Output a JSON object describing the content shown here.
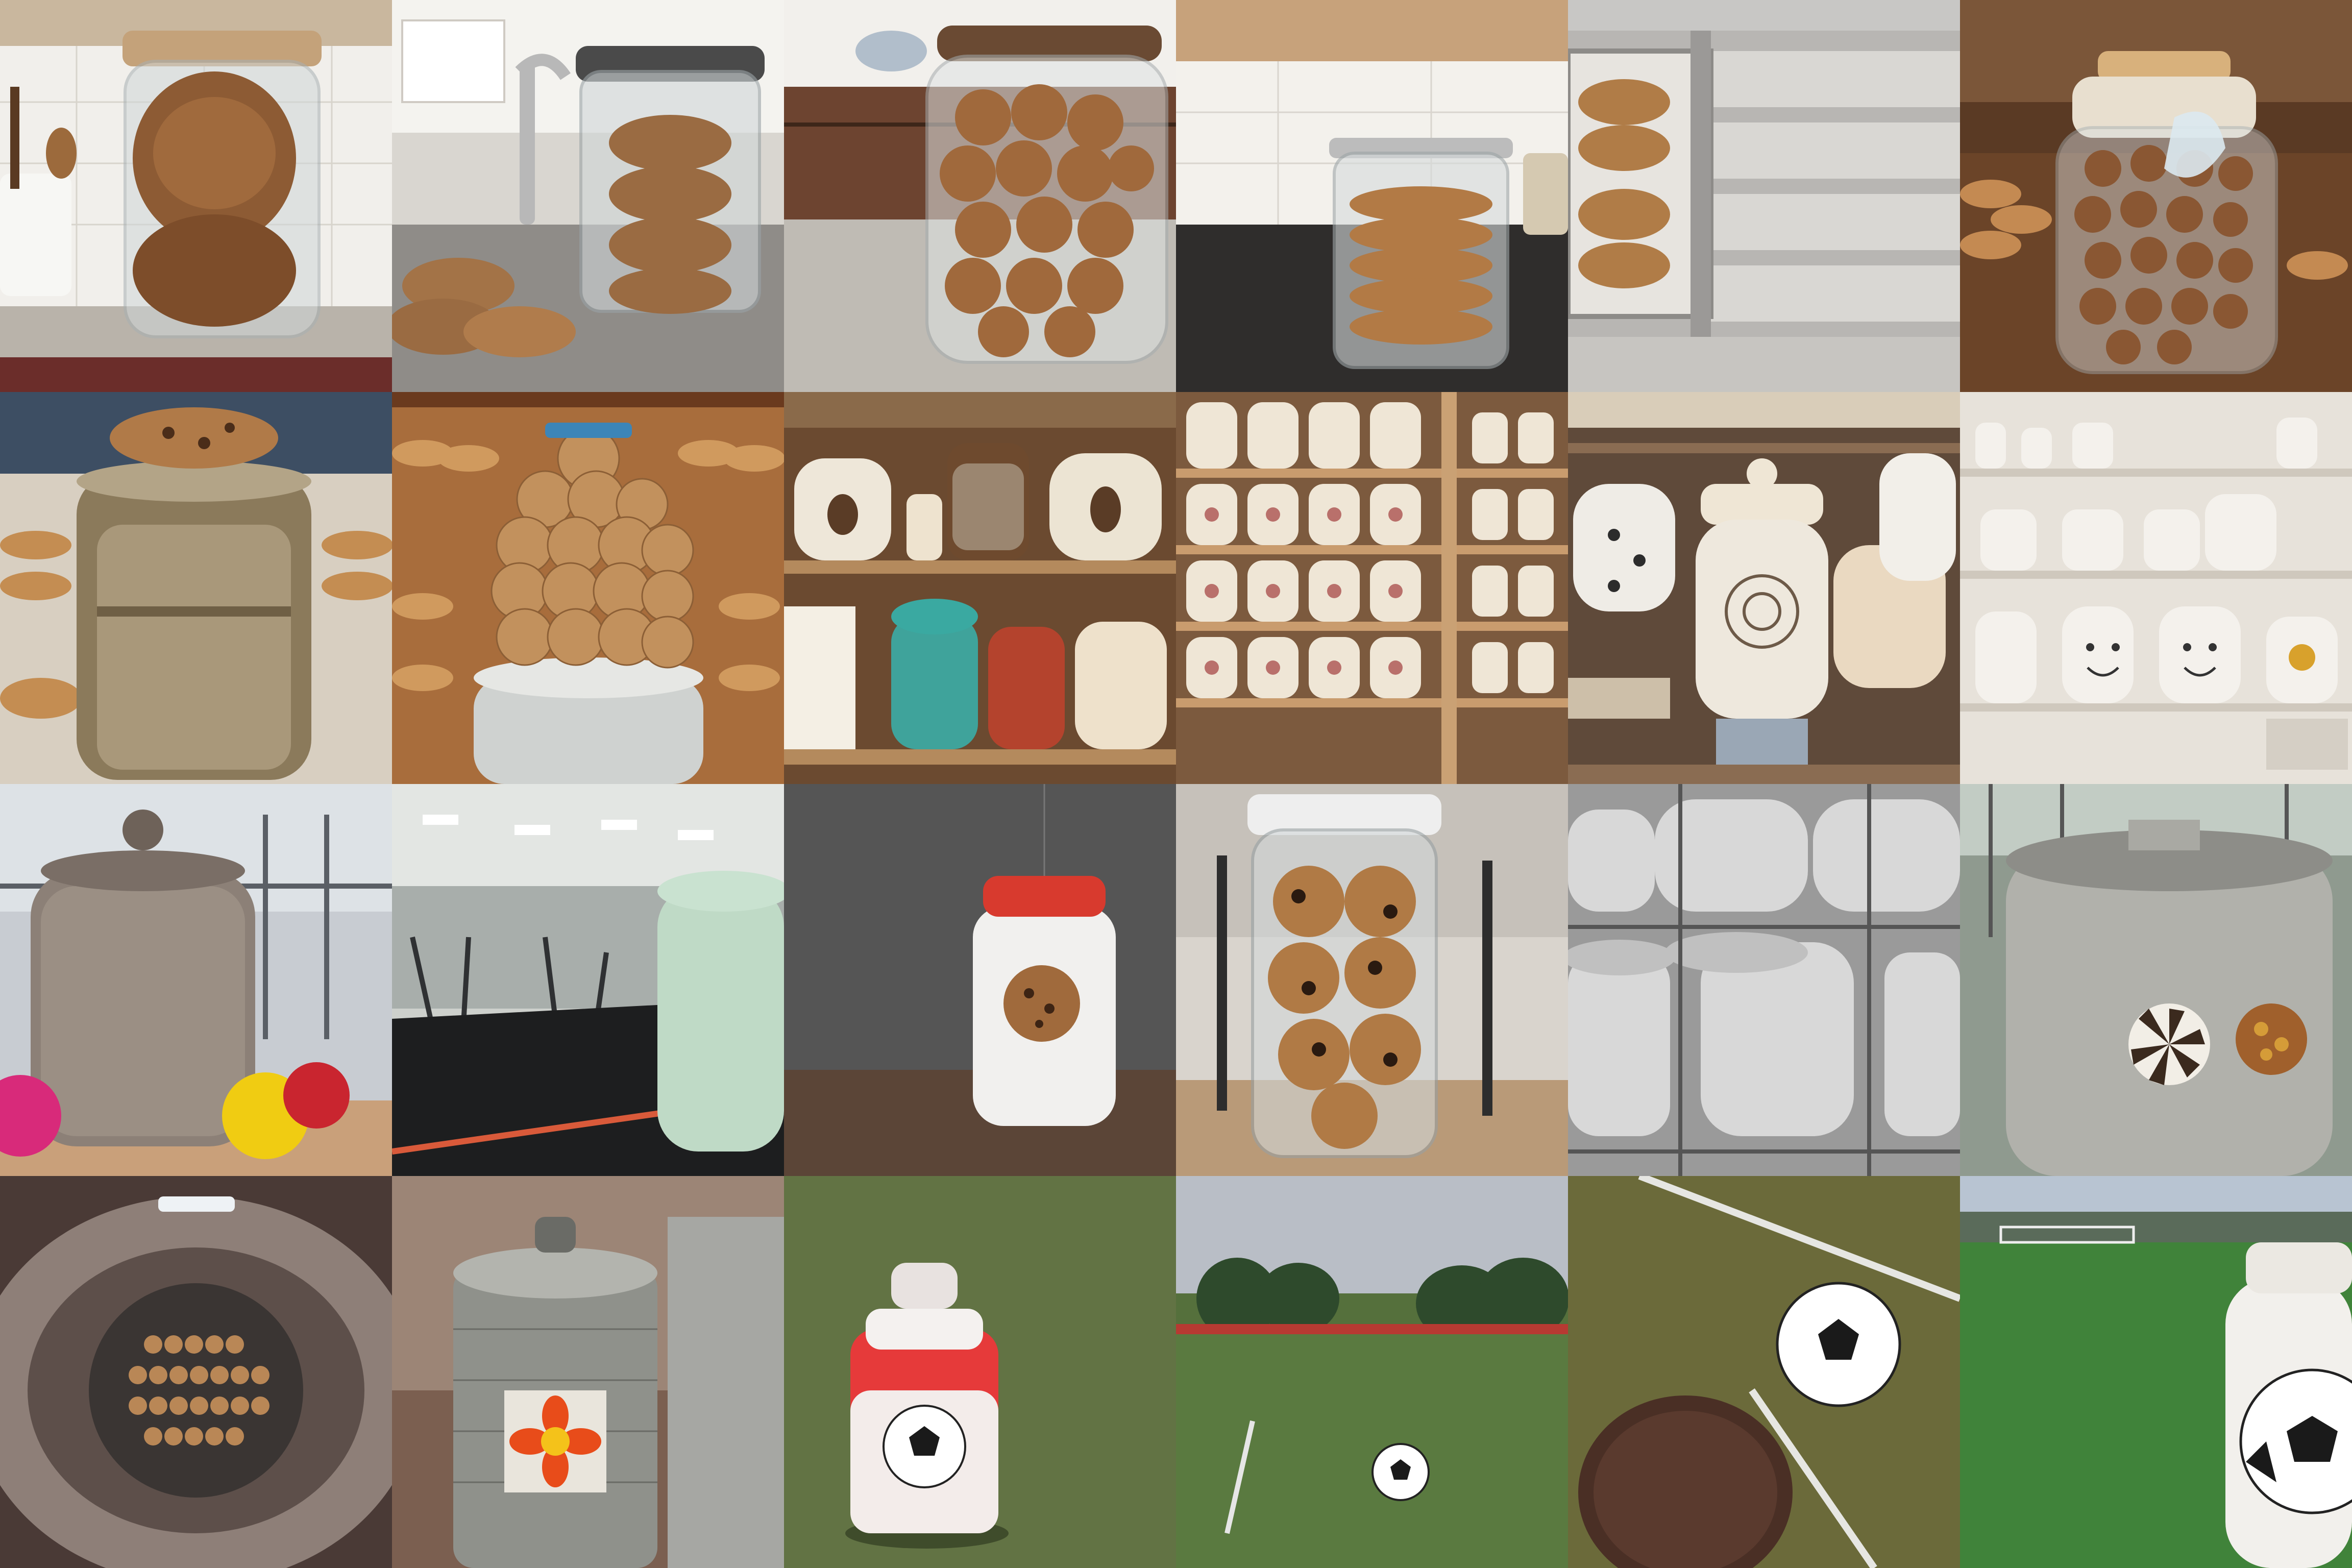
{
  "layout": {
    "rows": 4,
    "columns": 6
  },
  "tiles": [
    {
      "row": 1,
      "col": 1,
      "scene": "kitchen-counter",
      "subject": "glass-jar-large-cookies"
    },
    {
      "row": 1,
      "col": 2,
      "scene": "kitchen-sink",
      "subject": "glass-jar-stacked-cookies"
    },
    {
      "row": 1,
      "col": 3,
      "scene": "kitchen-counter",
      "subject": "glass-jar-full-cookies"
    },
    {
      "row": 1,
      "col": 4,
      "scene": "kitchen-counter",
      "subject": "clip-top-jar-stacked-cookies"
    },
    {
      "row": 1,
      "col": 5,
      "scene": "metal-shelf",
      "subject": "cookies-behind-glass"
    },
    {
      "row": 1,
      "col": 6,
      "scene": "bakery-counter",
      "subject": "glass-jar-assorted-cookies"
    },
    {
      "row": 2,
      "col": 1,
      "scene": "bakery",
      "subject": "metal-canister-cookie-on-lid"
    },
    {
      "row": 2,
      "col": 2,
      "scene": "bakery",
      "subject": "jar-topped-with-cookie-tower"
    },
    {
      "row": 2,
      "col": 3,
      "scene": "shop-shelves",
      "subject": "ceramic-jars"
    },
    {
      "row": 2,
      "col": 4,
      "scene": "shop-shelves",
      "subject": "painted-ceramic-jar-rows"
    },
    {
      "row": 2,
      "col": 5,
      "scene": "shop-shelf",
      "subject": "speckled-ceramic-jar"
    },
    {
      "row": 2,
      "col": 6,
      "scene": "shop-shelves",
      "subject": "ceramic-face-jars"
    },
    {
      "row": 3,
      "col": 1,
      "scene": "gym",
      "subject": "speckled-jar-with-balls"
    },
    {
      "row": 3,
      "col": 2,
      "scene": "gym",
      "subject": "mint-green-jar"
    },
    {
      "row": 3,
      "col": 3,
      "scene": "studio",
      "subject": "white-jar-cookie-emblem"
    },
    {
      "row": 3,
      "col": 4,
      "scene": "gym",
      "subject": "glass-jar-chocolate-cookies"
    },
    {
      "row": 3,
      "col": 5,
      "scene": "industrial",
      "subject": "white-steel-tanks"
    },
    {
      "row": 3,
      "col": 6,
      "scene": "industrial",
      "subject": "grey-tank-cookie-window"
    },
    {
      "row": 4,
      "col": 1,
      "scene": "vault",
      "subject": "round-vault-of-cookies"
    },
    {
      "row": 4,
      "col": 2,
      "scene": "factory",
      "subject": "steel-tank-flower-emblem"
    },
    {
      "row": 4,
      "col": 3,
      "scene": "soccer-field",
      "subject": "red-white-jar-with-ball"
    },
    {
      "row": 4,
      "col": 4,
      "scene": "soccer-field",
      "subject": "ball-on-grass"
    },
    {
      "row": 4,
      "col": 5,
      "scene": "soccer-field",
      "subject": "cookie-and-ball"
    },
    {
      "row": 4,
      "col": 6,
      "scene": "soccer-field",
      "subject": "soccer-ball-jar"
    }
  ]
}
